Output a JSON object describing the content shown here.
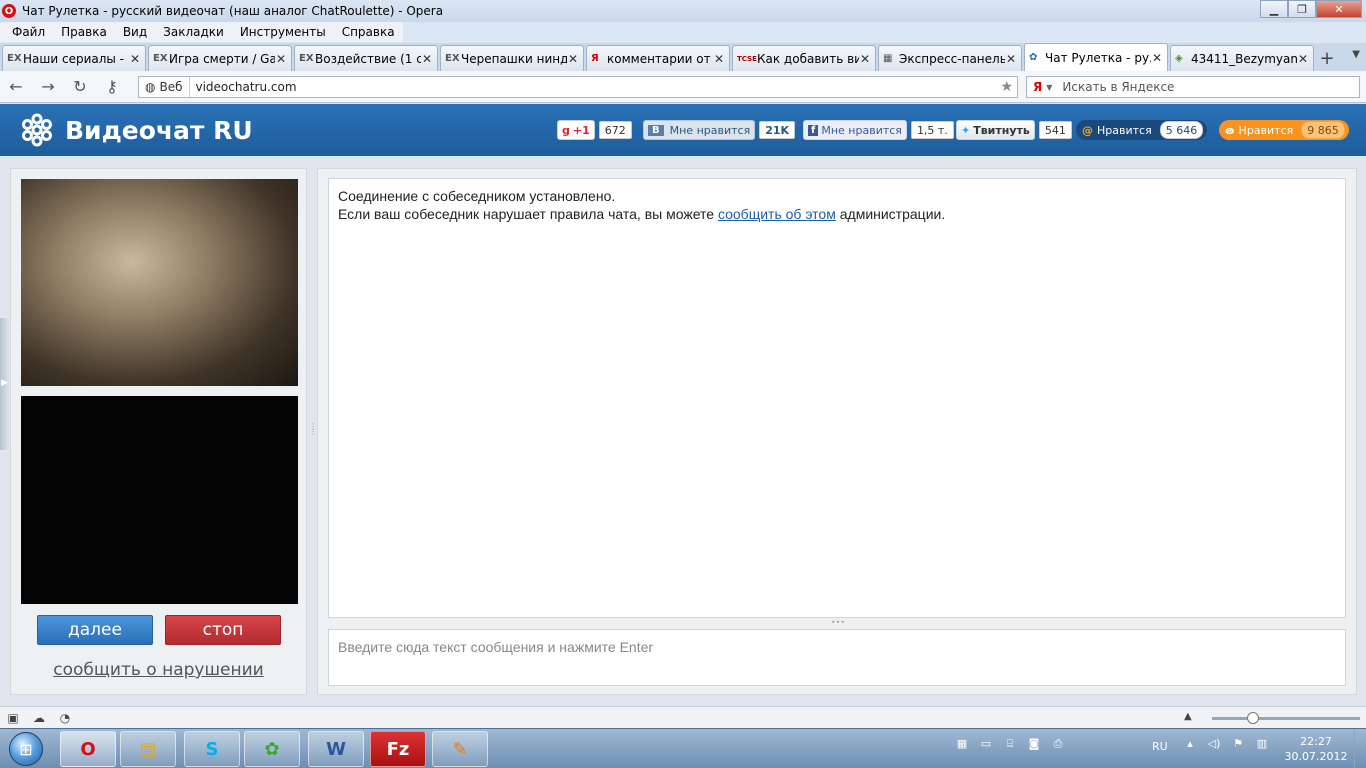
{
  "window": {
    "title": "Чат Рулетка - русский видеочат (наш аналог ChatRoulette) - Opera",
    "minimize": "▁",
    "maximize": "❐",
    "close": "✕"
  },
  "menu": [
    "Файл",
    "Правка",
    "Вид",
    "Закладки",
    "Инструменты",
    "Справка"
  ],
  "tabs": [
    {
      "icon": "EX",
      "label": "Наши сериалы - ..."
    },
    {
      "icon": "EX",
      "label": "Игра смерти / Ga..."
    },
    {
      "icon": "EX",
      "label": "Воздействие (1 с..."
    },
    {
      "icon": "EX",
      "label": "Черепашки ниндзя..."
    },
    {
      "icon": "Я",
      "label": "комментарии от ..."
    },
    {
      "icon": "TCSE",
      "label": "Как добавить вид..."
    },
    {
      "icon": "▦",
      "label": "Экспресс-панель"
    },
    {
      "icon": "✿",
      "label": "Чат Рулетка - ру..."
    },
    {
      "icon": "◈",
      "label": "43411_Bezymyan..."
    }
  ],
  "address": {
    "web_label": "Веб",
    "url": "videochatru.com",
    "search_placeholder": "Искать в Яндексе",
    "search_engine": "Я"
  },
  "site": {
    "logo_text": "Видеочат RU",
    "social": {
      "gplus_label": "+1",
      "gplus_count": "672",
      "vk_label": "Мне нравится",
      "vk_count": "21K",
      "fb_label": "Мне нравится",
      "fb_count": "1,5 т.",
      "tw_label": "Твитнуть",
      "tw_count": "541",
      "mail_label": "Нравится",
      "mail_count": "5 646",
      "ok_label": "Нравится",
      "ok_count": "9 865"
    }
  },
  "chat": {
    "line1": "Соединение с собеседником установлено.",
    "line2_before": "Если ваш собеседник нарушает правила чата, вы можете ",
    "line2_link": "сообщить об этом",
    "line2_after": " администрации.",
    "input_placeholder": "Введите сюда текст сообщения и нажмите Enter"
  },
  "controls": {
    "next_label": "далее",
    "stop_label": "стоп",
    "report_label": "сообщить о нарушении"
  },
  "taskbar": {
    "lang": "RU",
    "time": "22:27",
    "date": "30.07.2012"
  },
  "colors": {
    "header_blue": "#2167ac",
    "next_blue": "#3a85cf",
    "stop_red": "#c63a3f"
  }
}
